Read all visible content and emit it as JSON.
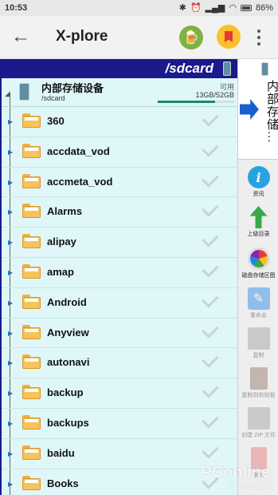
{
  "status": {
    "time": "10:53",
    "battery": "86%"
  },
  "appbar": {
    "title": "X-plore"
  },
  "path": {
    "current": "/sdcard"
  },
  "storage": {
    "name": "内部存储设备",
    "path": "/sdcard",
    "available_label": "可用",
    "usage": "13GB/52GB",
    "used_fraction": 0.75
  },
  "folders": [
    {
      "name": "360"
    },
    {
      "name": "accdata_vod"
    },
    {
      "name": "accmeta_vod"
    },
    {
      "name": "Alarms"
    },
    {
      "name": "alipay"
    },
    {
      "name": "amap"
    },
    {
      "name": "Android"
    },
    {
      "name": "Anyview"
    },
    {
      "name": "autonavi"
    },
    {
      "name": "backup"
    },
    {
      "name": "backups"
    },
    {
      "name": "baidu"
    },
    {
      "name": "Books"
    }
  ],
  "sidebar": {
    "volume_label": "内部存储...",
    "tools": [
      {
        "label": "资讯",
        "icon": "info-icon"
      },
      {
        "label": "上级目录",
        "icon": "up-arrow-icon"
      },
      {
        "label": "磁盘存储区图",
        "icon": "disk-map-icon"
      },
      {
        "label": "重命名",
        "icon": "rename-icon"
      },
      {
        "label": "复制",
        "icon": "copy-icon"
      },
      {
        "label": "复制到剪贴板",
        "icon": "clipboard-icon"
      },
      {
        "label": "创建 ZIP 文件",
        "icon": "zip-icon"
      },
      {
        "label": "删除",
        "icon": "trash-icon"
      }
    ]
  },
  "watermark": {
    "brand": "PConline",
    "sub": "太平洋电脑网"
  }
}
